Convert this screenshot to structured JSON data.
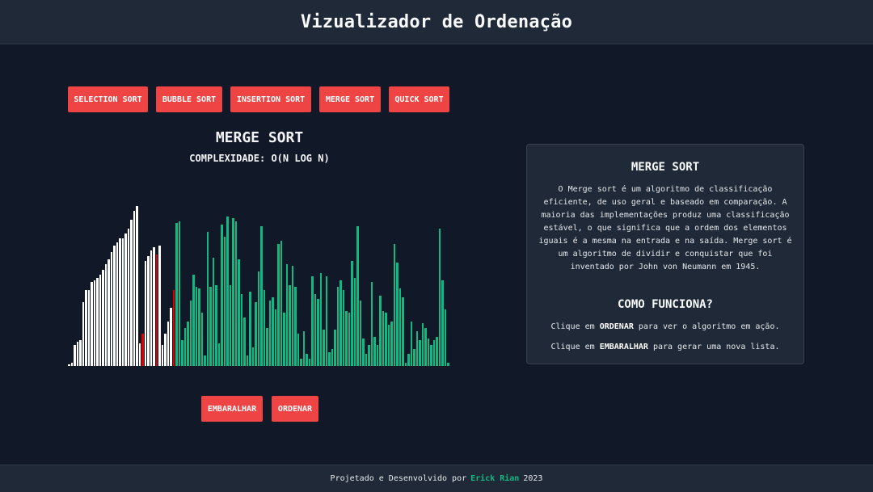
{
  "header": {
    "title": "Vizualizador de Ordenação"
  },
  "algorithms": [
    {
      "label": "SELECTION SORT"
    },
    {
      "label": "BUBBLE SORT"
    },
    {
      "label": "INSERTION SORT"
    },
    {
      "label": "MERGE SORT"
    },
    {
      "label": "QUICK SORT"
    }
  ],
  "visualizer": {
    "title": "MERGE SORT",
    "complexity": "COMPLEXIDADE: O(N LOG N)",
    "colors": {
      "sorted": "#ffffff",
      "active": "#e00000",
      "unsorted": "#10b981"
    },
    "bars": {
      "values": [
        1,
        2,
        12,
        14,
        15,
        37,
        44,
        44,
        49,
        50,
        51,
        53,
        56,
        59,
        62,
        66,
        70,
        72,
        74,
        74,
        77,
        80,
        85,
        90,
        93,
        13,
        19,
        61,
        64,
        67,
        69,
        65,
        70,
        12,
        19,
        26,
        34,
        44,
        83,
        84,
        15,
        22,
        26,
        38,
        53,
        46,
        45,
        31,
        6,
        78,
        46,
        63,
        47,
        13,
        82,
        75,
        87,
        47,
        86,
        84,
        62,
        42,
        28,
        6,
        43,
        11,
        37,
        55,
        81,
        44,
        22,
        38,
        40,
        33,
        71,
        73,
        31,
        59,
        47,
        58,
        46,
        19,
        4,
        20,
        7,
        4,
        52,
        42,
        39,
        54,
        21,
        52,
        8,
        10,
        21,
        46,
        50,
        44,
        32,
        31,
        61,
        51,
        81,
        38,
        16,
        7,
        12,
        49,
        17,
        12,
        41,
        32,
        31,
        24,
        26,
        71,
        60,
        45,
        40,
        2,
        7,
        26,
        10,
        20,
        15,
        25,
        22,
        16,
        12,
        15,
        17,
        80,
        50,
        33,
        2
      ],
      "states": [
        "s",
        "s",
        "s",
        "s",
        "s",
        "s",
        "s",
        "s",
        "s",
        "s",
        "s",
        "s",
        "s",
        "s",
        "s",
        "s",
        "s",
        "s",
        "s",
        "s",
        "s",
        "s",
        "s",
        "s",
        "s",
        "s",
        "a",
        "s",
        "s",
        "s",
        "s",
        "a",
        "s",
        "s",
        "s",
        "s",
        "s",
        "a",
        "u",
        "u",
        "u",
        "u",
        "u",
        "u",
        "u",
        "u",
        "u",
        "u",
        "u",
        "u",
        "u",
        "u",
        "u",
        "u",
        "u",
        "u",
        "u",
        "u",
        "u",
        "u",
        "u",
        "u",
        "u",
        "u",
        "u",
        "u",
        "u",
        "u",
        "u",
        "u",
        "u",
        "u",
        "u",
        "u",
        "u",
        "u",
        "u",
        "u",
        "u",
        "u",
        "u",
        "u",
        "u",
        "u",
        "u",
        "u",
        "u",
        "u",
        "u",
        "u",
        "u",
        "u",
        "u",
        "u",
        "u",
        "u",
        "u",
        "u",
        "u",
        "u",
        "u",
        "u",
        "u",
        "u",
        "u",
        "u",
        "u",
        "u",
        "u",
        "u",
        "u",
        "u",
        "u",
        "u",
        "u",
        "u",
        "u",
        "u",
        "u",
        "u",
        "u",
        "u",
        "u",
        "u",
        "u",
        "u",
        "u",
        "u",
        "u",
        "u",
        "u",
        "u",
        "u",
        "u",
        "u",
        "u",
        "u",
        "u",
        "u",
        "u",
        "u",
        "u",
        "u",
        "u",
        "u",
        "u",
        "u",
        "u",
        "u",
        "u",
        "u",
        "u",
        "u",
        "u",
        "u",
        "u",
        "u",
        "u",
        "u",
        "u",
        "u"
      ],
      "max": 100
    }
  },
  "actions": {
    "shuffle_label": "EMBARALHAR",
    "sort_label": "ORDENAR"
  },
  "info": {
    "title": "MERGE SORT",
    "description": "O Merge sort é um algoritmo de classificação eficiente, de uso geral e baseado em comparação. A maioria das implementações produz uma classificação estável, o que significa que a ordem dos elementos iguais é a mesma na entrada e na saída. Merge sort é um algoritmo de dividir e conquistar que foi inventado por John von Neumann em 1945.",
    "how_title": "COMO FUNCIONA?",
    "step1": {
      "pre": "Clique em ",
      "keyword": "ORDENAR",
      "post": " para ver o algoritmo em ação."
    },
    "step2": {
      "pre": "Clique em ",
      "keyword": "EMBARALHAR",
      "post": " para gerar uma nova lista."
    }
  },
  "footer": {
    "prefix": "Projetado e Desenvolvido por",
    "author": "Erick Rian",
    "year": "2023"
  }
}
